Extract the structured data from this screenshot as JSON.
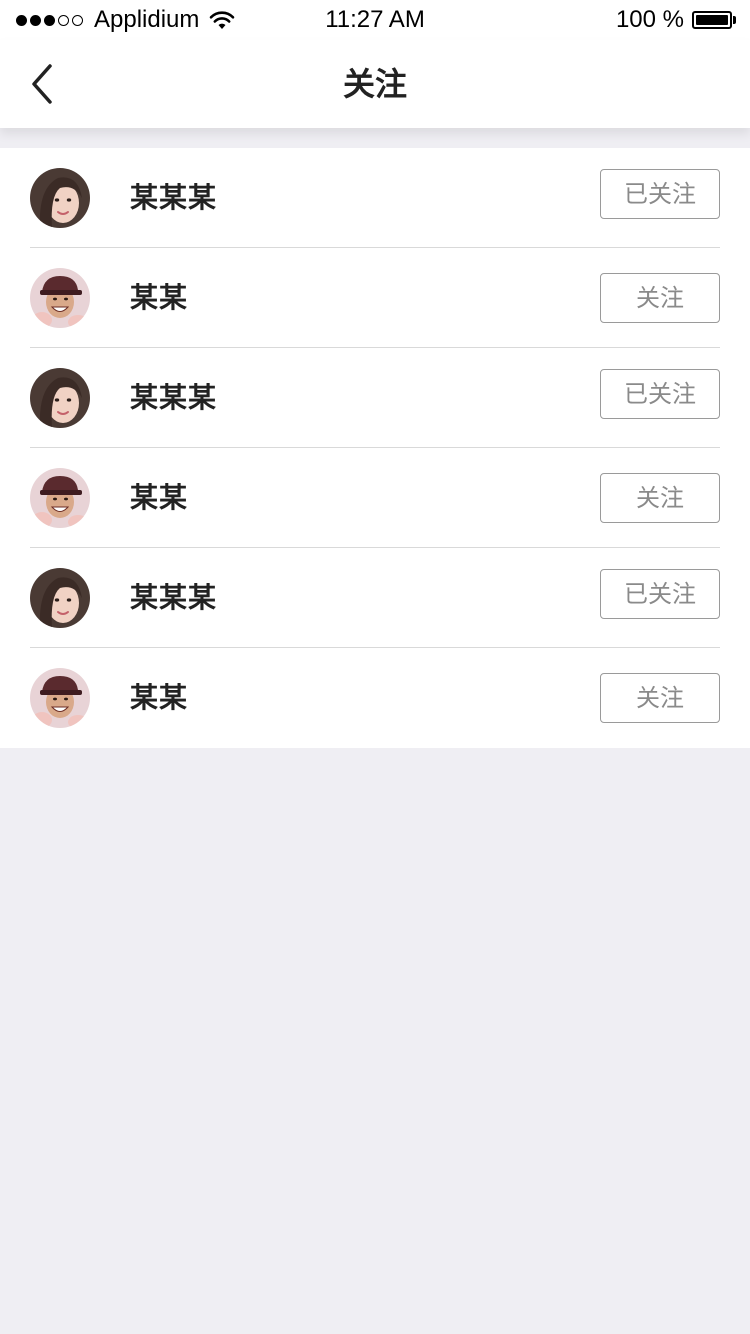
{
  "status_bar": {
    "carrier": "Applidium",
    "time": "11:27 AM",
    "battery": "100 %"
  },
  "nav": {
    "title": "关注",
    "back_icon": "chevron-left-icon"
  },
  "users": [
    {
      "name": "某某某",
      "follow_label": "已关注",
      "avatar": "woman"
    },
    {
      "name": "某某",
      "follow_label": "关注",
      "avatar": "man"
    },
    {
      "name": "某某某",
      "follow_label": "已关注",
      "avatar": "woman"
    },
    {
      "name": "某某",
      "follow_label": "关注",
      "avatar": "man"
    },
    {
      "name": "某某某",
      "follow_label": "已关注",
      "avatar": "woman"
    },
    {
      "name": "某某",
      "follow_label": "关注",
      "avatar": "man"
    }
  ],
  "colors": {
    "background": "#efeef3",
    "button_border": "#9a9a9a",
    "button_text": "#8a8a8a"
  }
}
